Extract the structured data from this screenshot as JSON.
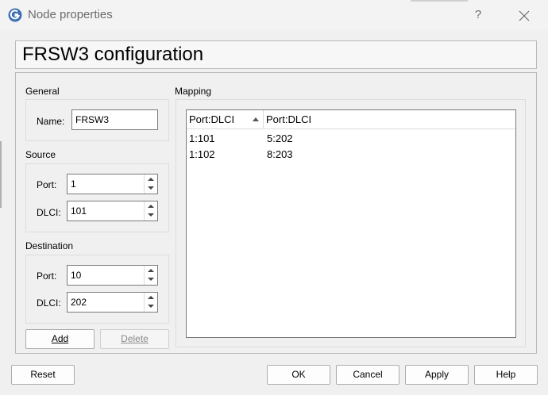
{
  "window": {
    "title": "Node properties",
    "help_label": "?"
  },
  "heading": "FRSW3 configuration",
  "general": {
    "label": "General",
    "name_label": "Name:",
    "name_value": "FRSW3"
  },
  "source": {
    "label": "Source",
    "port_label": "Port:",
    "port_value": "1",
    "dlci_label": "DLCI:",
    "dlci_value": "101"
  },
  "destination": {
    "label": "Destination",
    "port_label": "Port:",
    "port_value": "10",
    "dlci_label": "DLCI:",
    "dlci_value": "202"
  },
  "actions": {
    "add_label": "Add",
    "delete_label": "Delete"
  },
  "mapping": {
    "label": "Mapping",
    "columns": [
      "Port:DLCI",
      "Port:DLCI"
    ],
    "rows": [
      {
        "src": "1:101",
        "dst": "5:202"
      },
      {
        "src": "1:102",
        "dst": "8:203"
      }
    ]
  },
  "footer": {
    "reset_label": "Reset",
    "ok_label": "OK",
    "cancel_label": "Cancel",
    "apply_label": "Apply",
    "help_label": "Help"
  },
  "colors": {
    "window_bg": "#f0f0f0",
    "title_text": "#6b6b6b",
    "disabled_text": "#8a8a8a"
  }
}
